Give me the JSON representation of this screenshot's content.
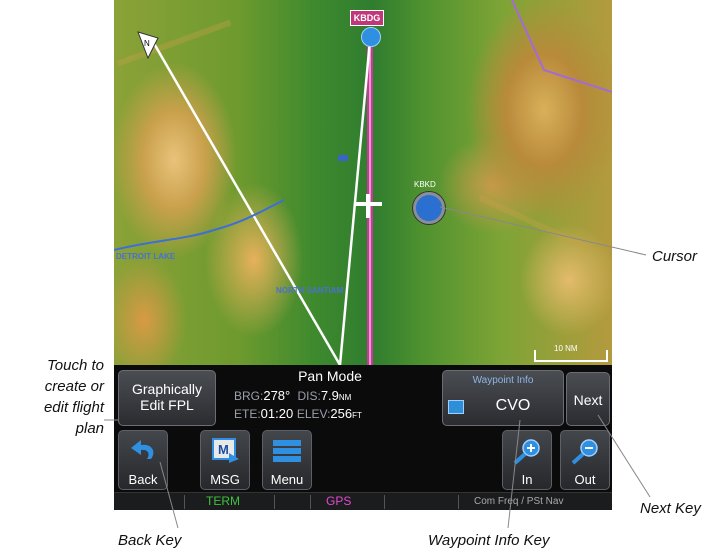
{
  "map": {
    "airport_tag": "KBDG",
    "cursor_label": "KBKD",
    "scale_label": "10 NM",
    "lake_label": "DETROIT LAKE",
    "river_label": "NORTH SANTIAM"
  },
  "info_bar": {
    "graphically_edit_label_line1": "Graphically",
    "graphically_edit_label_line2": "Edit FPL",
    "pan_title": "Pan Mode",
    "brg_label": "BRG:",
    "brg_value": "278°",
    "dis_label": "DIS:",
    "dis_value": "7.9",
    "dis_unit": "NM",
    "ete_label": "ETE:",
    "ete_value": "01:20",
    "elev_label": "ELEV:",
    "elev_value": "256",
    "elev_unit": "FT",
    "waypoint_info_title": "Waypoint Info",
    "waypoint_info_value": "CVO",
    "next_label": "Next"
  },
  "keys": {
    "back": "Back",
    "msg": "MSG",
    "menu": "Menu",
    "in": "In",
    "out": "Out"
  },
  "status_bar": {
    "term": "TERM",
    "gps": "GPS",
    "com": "Com Freq / PSt Nav"
  },
  "callouts": {
    "touch_line1": "Touch to",
    "touch_line2": "create or",
    "touch_line3": "edit flight",
    "touch_line4": "plan",
    "cursor": "Cursor",
    "next_key": "Next Key",
    "back_key": "Back Key",
    "waypoint_info_key": "Waypoint Info Key"
  },
  "colors": {
    "route_magenta": "#c63b9a",
    "route_white": "#ffffff",
    "term_green": "#3fc13f",
    "gps_magenta": "#e04ad0"
  }
}
